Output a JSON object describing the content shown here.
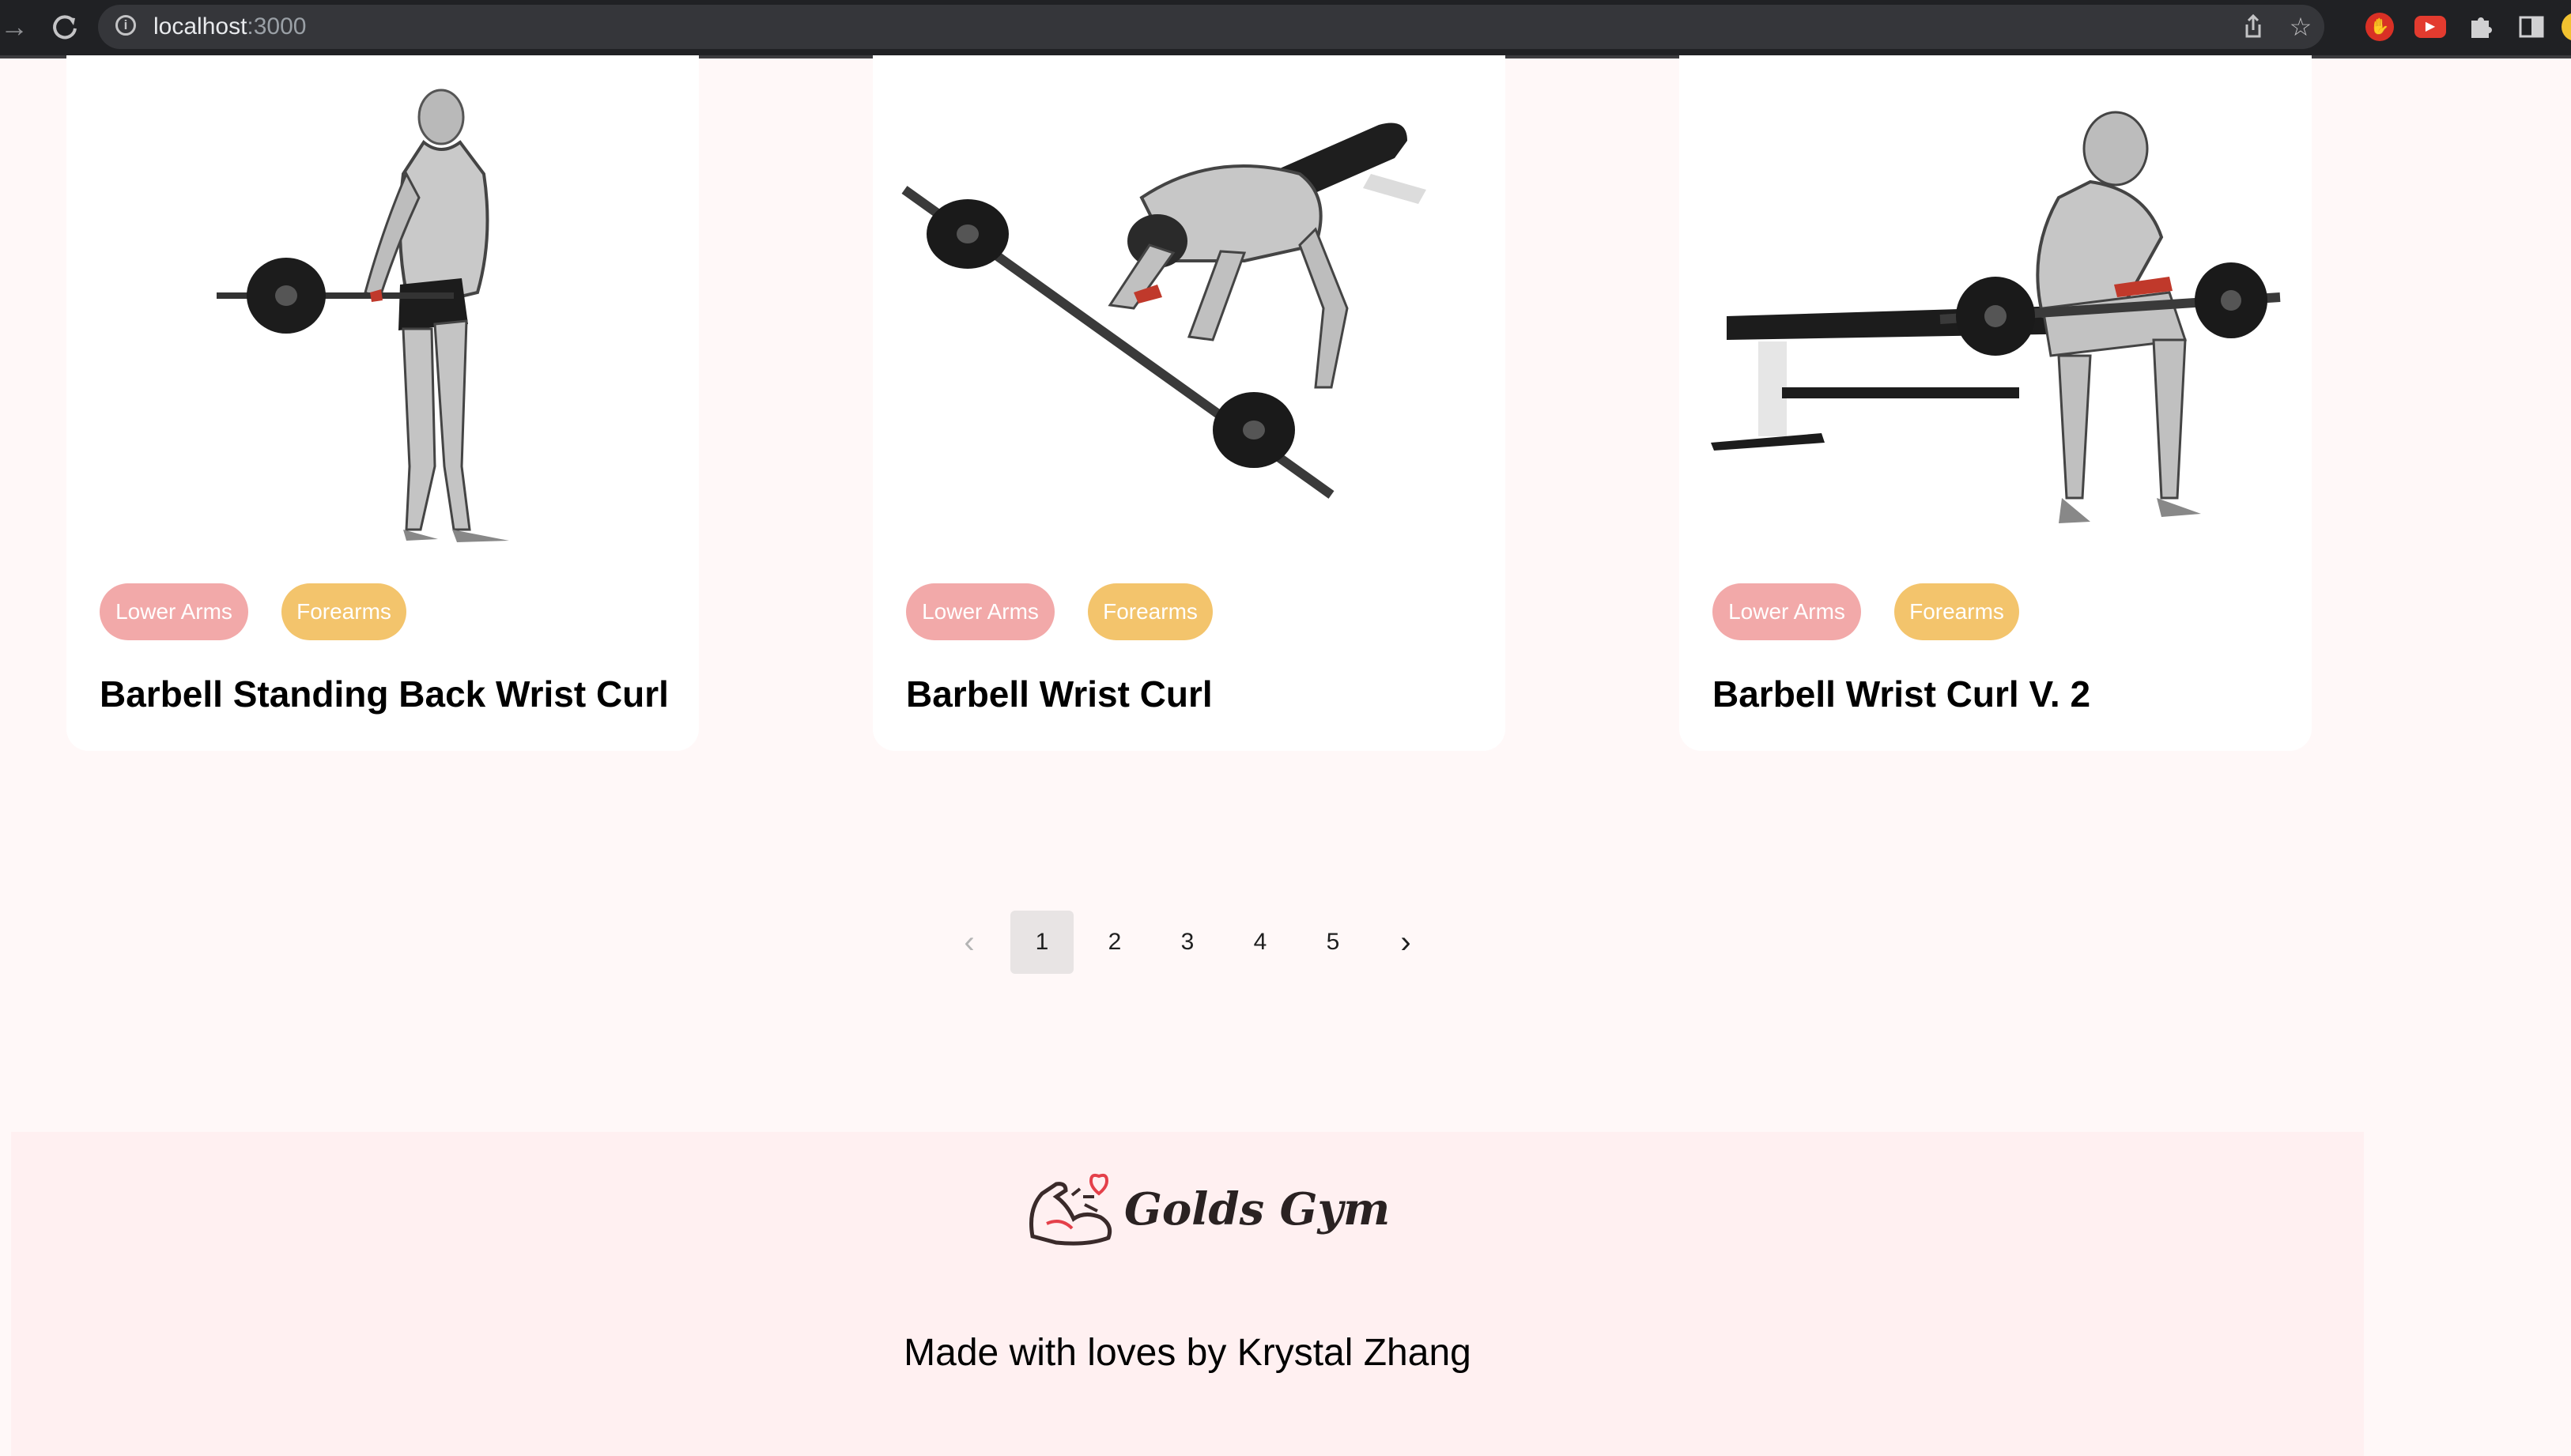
{
  "browser": {
    "url_host": "localhost",
    "url_port": ":3000",
    "icons": [
      "forward-icon",
      "reload-icon",
      "info-icon",
      "share-icon",
      "star-icon",
      "extension-red-icon",
      "extension-youtube-icon",
      "puzzle-icon",
      "sidebar-icon",
      "profile-icon"
    ]
  },
  "colors": {
    "body_part_tag": "#f2a9a9",
    "target_tag": "#f3c46c",
    "page_background": "#fff8f8",
    "footer_background": "#fff0f1",
    "logo_accent": "#e4404a"
  },
  "exercises": [
    {
      "title": "Barbell Standing Back Wrist Curl",
      "body_part": "Lower Arms",
      "target": "Forearms",
      "image": "man-standing-holding-barbell-behind-back"
    },
    {
      "title": "Barbell Wrist Curl",
      "body_part": "Lower Arms",
      "target": "Forearms",
      "image": "man-kneeling-on-bench-with-barbell"
    },
    {
      "title": "Barbell Wrist Curl V. 2",
      "body_part": "Lower Arms",
      "target": "Forearms",
      "image": "man-seated-on-bench-wrist-curl"
    }
  ],
  "pagination": {
    "prev": "‹",
    "pages": [
      "1",
      "2",
      "3",
      "4",
      "5"
    ],
    "current": "1",
    "next": "›"
  },
  "footer": {
    "brand": "Golds Gym",
    "credit": "Made with loves by Krystal Zhang"
  }
}
